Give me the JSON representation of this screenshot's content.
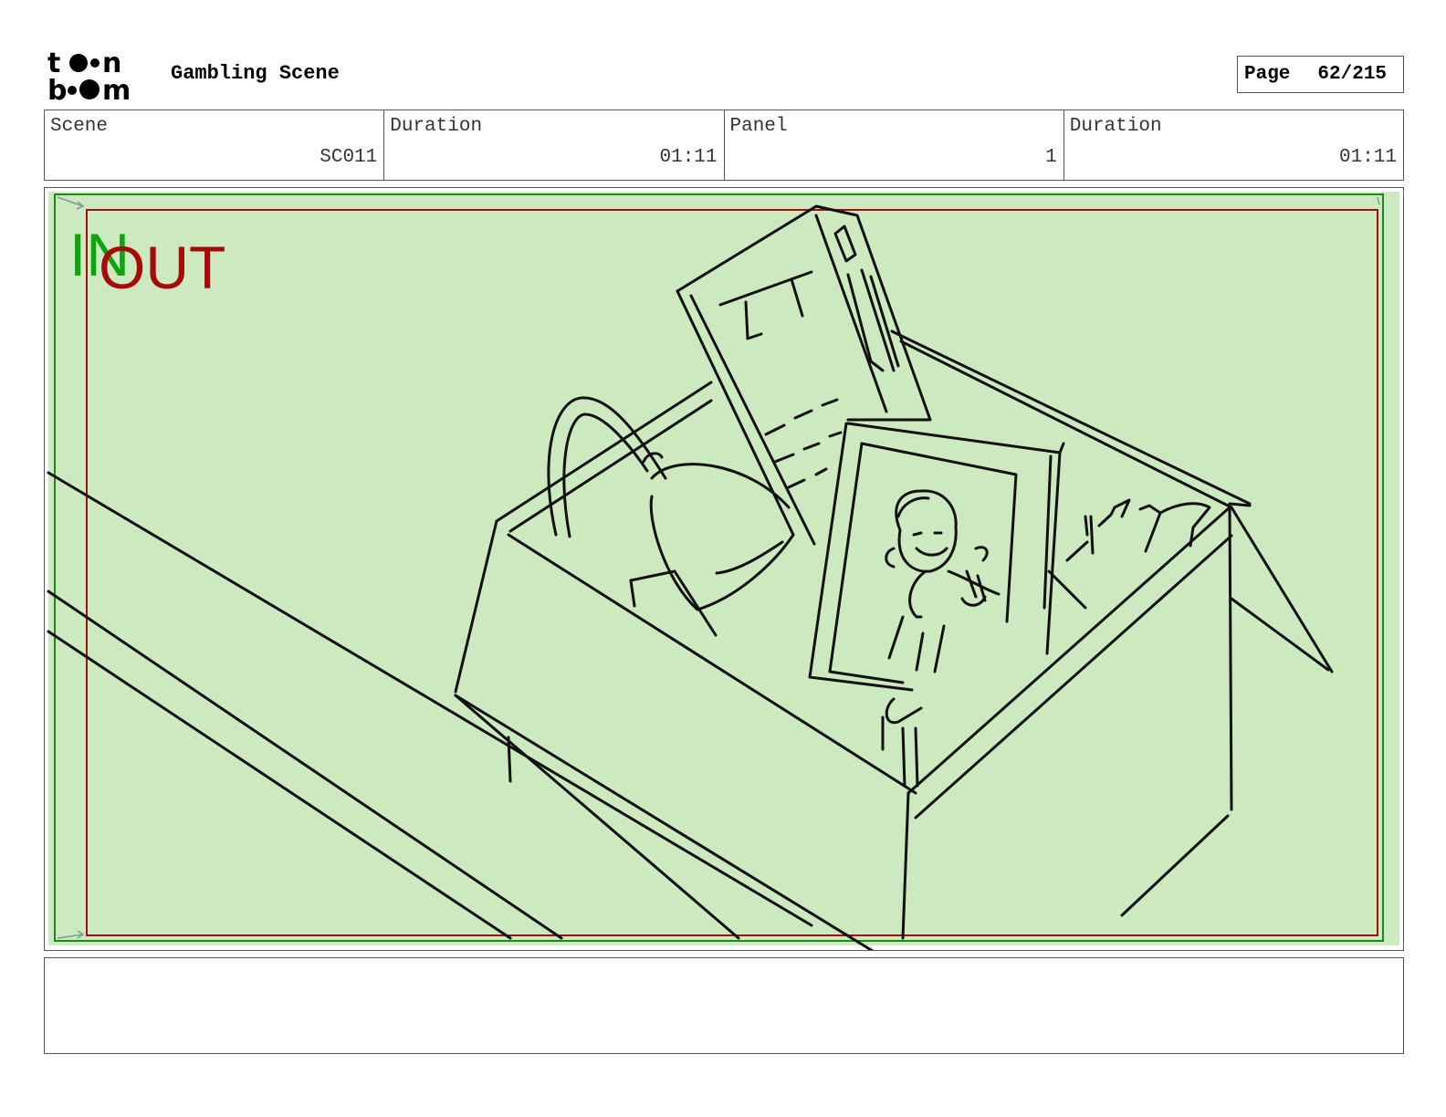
{
  "header": {
    "logo_icon": "toon-boom-logo",
    "project_title": "Gambling Scene",
    "page_label": "Page",
    "page_number": "62/215"
  },
  "info": {
    "scene_label": "Scene",
    "scene_value": "SC011",
    "scene_duration_label": "Duration",
    "scene_duration_value": "01:11",
    "panel_label": "Panel",
    "panel_value": "1",
    "panel_duration_label": "Duration",
    "panel_duration_value": "01:11"
  },
  "panel": {
    "in_label": "IN",
    "out_label": "OUT",
    "in_color": "#0fa30f",
    "out_color": "#a60b0b",
    "background_color": "#cde9c0"
  },
  "notes": {
    "text": ""
  }
}
